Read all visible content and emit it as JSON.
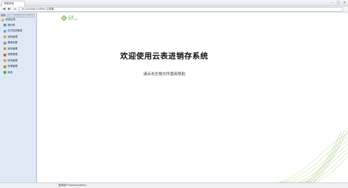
{
  "browser": {
    "tab_title": "网站系统",
    "url": "jxc.yunbiao.cn/Main 云表单"
  },
  "sidebar": {
    "search_label": "搜索",
    "search_placeholder": "输入名称或拼音首字母搜索",
    "root_label": "系统目录",
    "items": [
      {
        "label": "报价单",
        "icon_color": "#6a8fc7"
      },
      {
        "label": "应付应收账款",
        "icon_color": "#7fa3d6"
      },
      {
        "label": "采购管理",
        "icon_color": "#e2a63b"
      },
      {
        "label": "基础设置",
        "icon_color": "#8f8f8f"
      },
      {
        "label": "库存管理",
        "icon_color": "#c9a15e"
      },
      {
        "label": "销售管理",
        "icon_color": "#d45a4a"
      },
      {
        "label": "财务管理",
        "icon_color": "#d9a53a"
      },
      {
        "label": "权限管理",
        "icon_color": "#b98b2e"
      },
      {
        "label": "系统",
        "icon_color": "#5aa335"
      }
    ]
  },
  "main": {
    "logo_cn": "云表",
    "logo_en": "EASY STAR",
    "welcome": "欢迎使用云表进销存系统",
    "hint": "请点击左侧文件使用导航"
  },
  "statusbar": {
    "text": "登录用户:admin(admin)"
  },
  "colors": {
    "accent_green": "#5aa335",
    "sidebar_bg": "#dfe9f6"
  }
}
